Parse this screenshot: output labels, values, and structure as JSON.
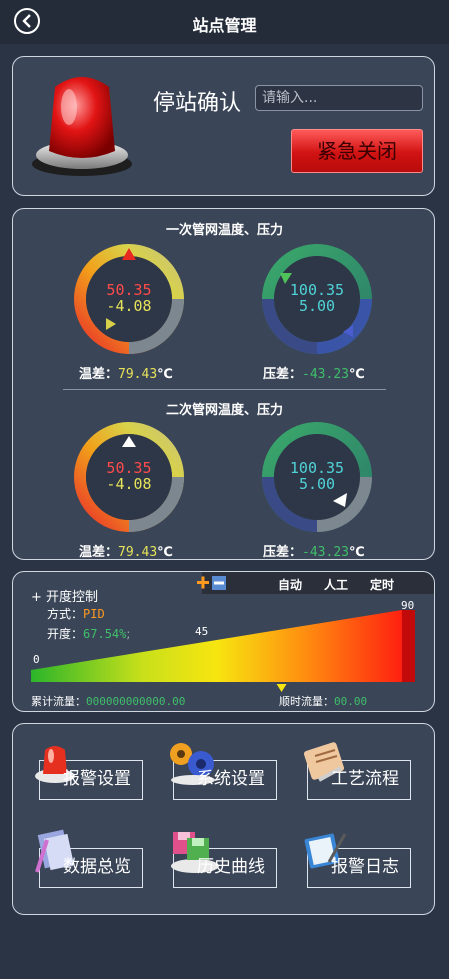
{
  "header": {
    "title": "站点管理"
  },
  "station": {
    "confirm_label": "停站确认",
    "input_placeholder": "请输入...",
    "emergency_label": "紧急关闭"
  },
  "network": {
    "primary_title": "一次管网温度、压力",
    "secondary_title": "二次管网温度、压力",
    "primary": {
      "temp": {
        "top": "50.35",
        "bottom": "-4.08",
        "cap_label": "温差：",
        "cap_value": "79.43",
        "cap_unit": "℃"
      },
      "press": {
        "top": "100.35",
        "bottom": "5.00",
        "cap_label": "压差：",
        "cap_value": "-43.23",
        "cap_unit": "℃"
      }
    },
    "secondary": {
      "temp": {
        "top": "50.35",
        "bottom": "-4.08",
        "cap_label": "温差：",
        "cap_value": "79.43",
        "cap_unit": "℃"
      },
      "press": {
        "top": "100.35",
        "bottom": "5.00",
        "cap_label": "压差：",
        "cap_value": "-43.23",
        "cap_unit": "℃"
      }
    }
  },
  "opening": {
    "title": "+ 开度控制",
    "mode_label": "方式：",
    "mode_value": "PID",
    "open_label": "开度：",
    "open_value": "67.54%",
    "open_value_fraction": 0.6754,
    "tabs": [
      "自动",
      "人工",
      "定时"
    ],
    "scale_min": "0",
    "scale_mid": "45",
    "scale_max": "90",
    "total_flow_label": "累计流量：",
    "total_flow_value": "000000000000.00",
    "instant_flow_label": "顺时流量：",
    "instant_flow_value": "00.00",
    "colors": {
      "accent": "#ff9a1f",
      "green_value": "#3fbf6a",
      "red_value": "#ff4a4a",
      "cyan_value": "#4fd3d8",
      "yellow_value": "#e6e25a"
    }
  },
  "menu": {
    "items": [
      {
        "label": "报警设置",
        "icon": "alarm-icon"
      },
      {
        "label": "系统设置",
        "icon": "gears-icon"
      },
      {
        "label": "工艺流程",
        "icon": "process-icon"
      },
      {
        "label": "数据总览",
        "icon": "notebook-icon"
      },
      {
        "label": "历史曲线",
        "icon": "disks-icon"
      },
      {
        "label": "报警日志",
        "icon": "log-icon"
      }
    ]
  }
}
